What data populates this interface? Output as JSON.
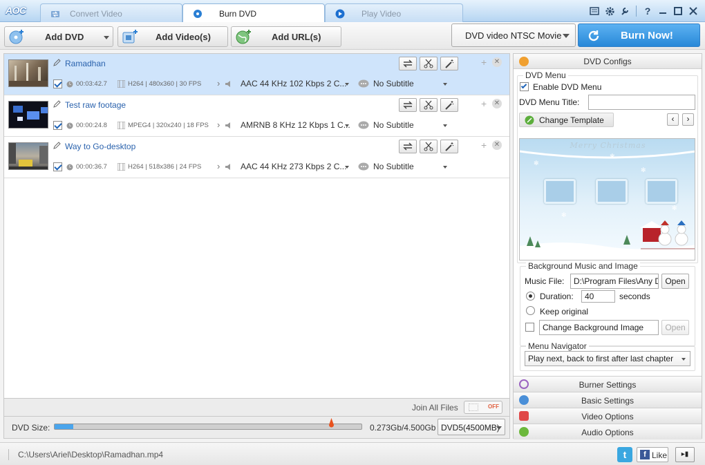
{
  "app": {
    "logo": "AOC"
  },
  "tabs": [
    {
      "label": "Convert Video",
      "active": false
    },
    {
      "label": "Burn DVD",
      "active": true
    },
    {
      "label": "Play Video",
      "active": false
    }
  ],
  "toolbar": {
    "add_dvd": "Add DVD",
    "add_videos": "Add Video(s)",
    "add_urls": "Add URL(s)",
    "profile": "DVD video NTSC Movie",
    "burn_now": "Burn Now!"
  },
  "files": [
    {
      "name": "Ramadhan",
      "duration": "00:03:42.7",
      "video": "H264 | 480x360 | 30 FPS",
      "audio": "AAC 44 KHz 102 Kbps 2 C...",
      "subtitle": "No Subtitle",
      "selected": true
    },
    {
      "name": "Test raw footage",
      "duration": "00:00:24.8",
      "video": "MPEG4 | 320x240 | 18 FPS",
      "audio": "AMRNB 8 KHz 12 Kbps 1 C...",
      "subtitle": "No Subtitle",
      "selected": false
    },
    {
      "name": "Way to Go-desktop",
      "duration": "00:00:36.7",
      "video": "H264 | 518x386 | 24 FPS",
      "audio": "AAC 44 KHz 273 Kbps 2 C...",
      "subtitle": "No Subtitle",
      "selected": false
    }
  ],
  "join": {
    "label": "Join All Files",
    "state": "OFF"
  },
  "dvd_size": {
    "label": "DVD Size:",
    "value": "0.273Gb/4.500Gb",
    "used_fraction": 0.06,
    "disc": "DVD5(4500MB)"
  },
  "panel": {
    "title": "DVD Configs",
    "dvd_menu": {
      "group": "DVD Menu",
      "enable_label": "Enable DVD Menu",
      "title_label": "DVD Menu Title:",
      "title_value": "",
      "change_template": "Change Template",
      "template_text": "Merry Christmas"
    },
    "bg": {
      "group": "Background Music and Image",
      "music_label": "Music File:",
      "music_value": "D:\\Program Files\\Any DVD",
      "open": "Open",
      "duration_label": "Duration:",
      "duration_value": "40",
      "seconds": "seconds",
      "keep_original": "Keep original",
      "change_bg": "Change Background Image",
      "open2": "Open"
    },
    "nav": {
      "group": "Menu Navigator",
      "value": "Play next, back to first after last chapter"
    },
    "sections": [
      "Burner Settings",
      "Basic Settings",
      "Video Options",
      "Audio Options"
    ]
  },
  "status": {
    "path": "C:\\Users\\Ariel\\Desktop\\Ramadhan.mp4",
    "twitter": "t",
    "like": "Like"
  },
  "colors": {
    "accent": "#2888d8",
    "selected_row": "#cfe4fb",
    "link": "#2a62ad"
  }
}
